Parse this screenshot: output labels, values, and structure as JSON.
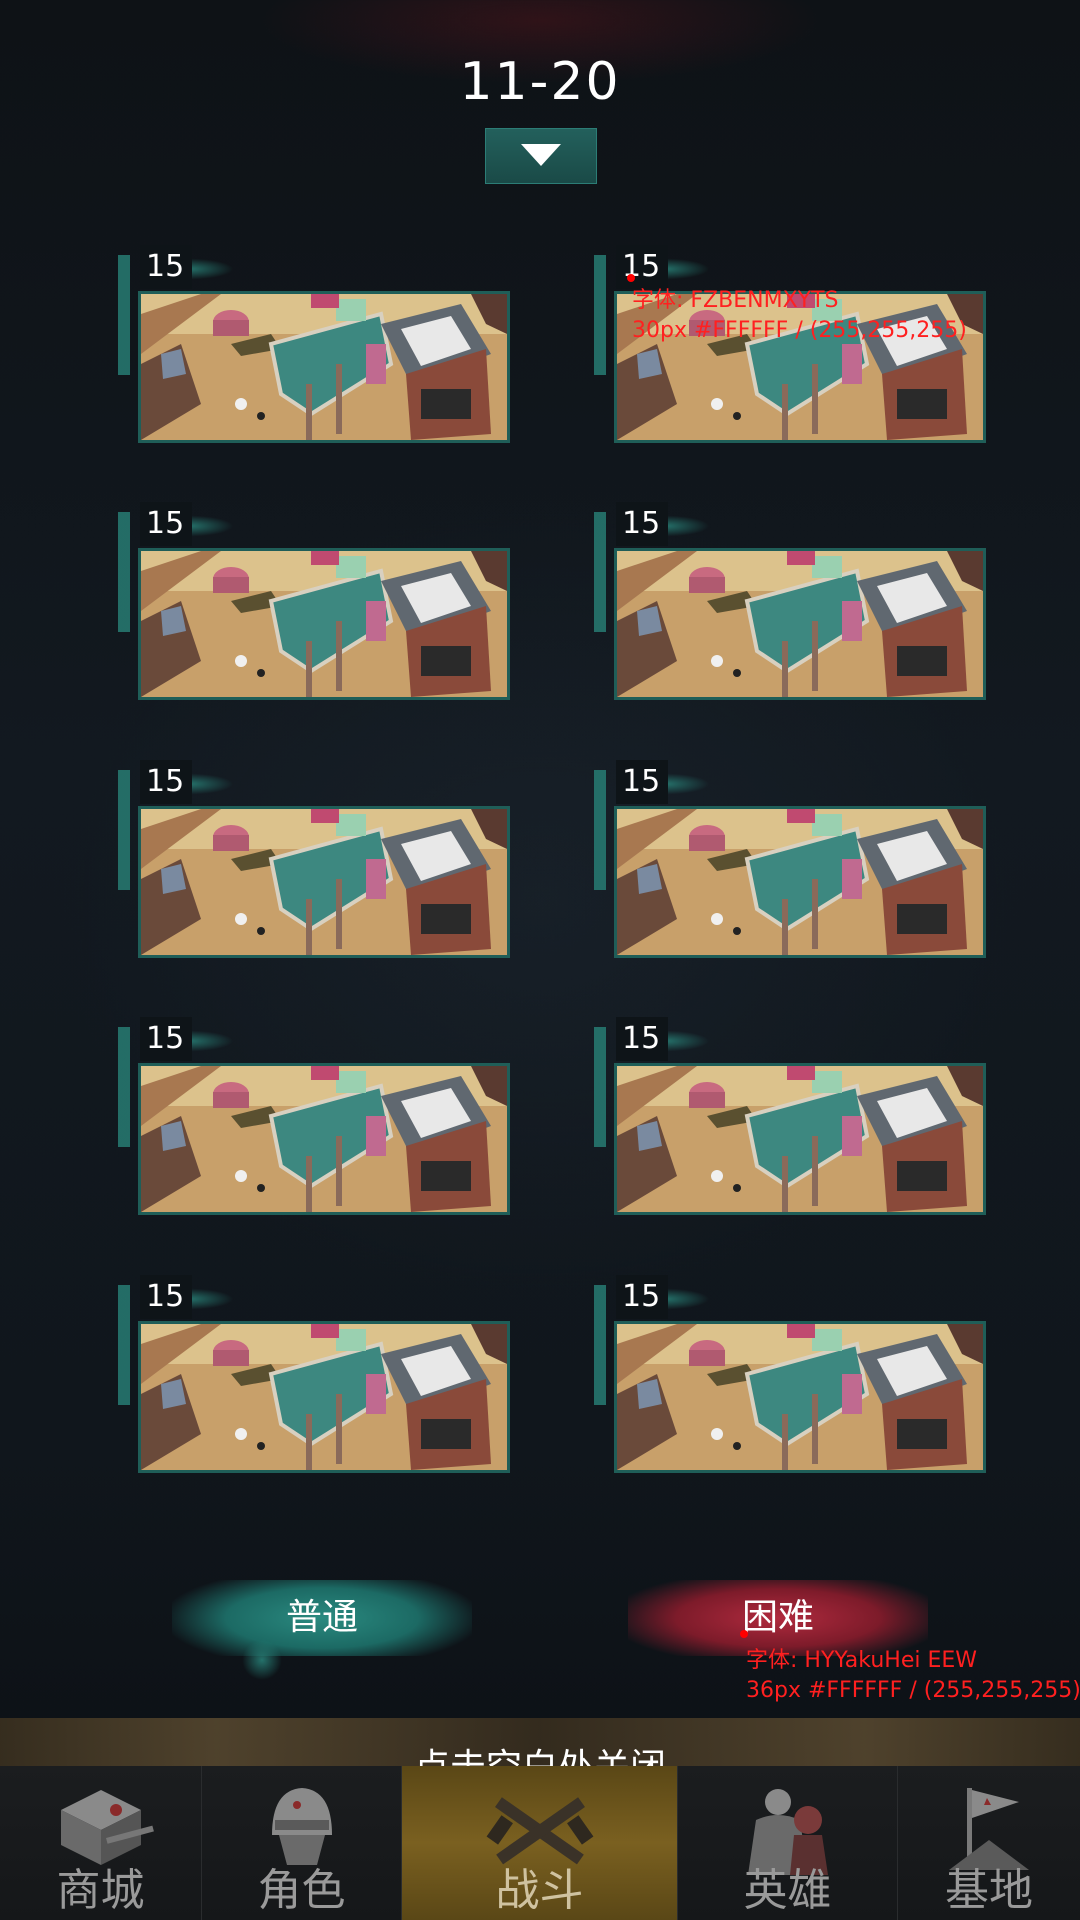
{
  "header": {
    "range_title": "11-20"
  },
  "levels": [
    {
      "number": "15"
    },
    {
      "number": "15"
    },
    {
      "number": "15"
    },
    {
      "number": "15"
    },
    {
      "number": "15"
    },
    {
      "number": "15"
    },
    {
      "number": "15"
    },
    {
      "number": "15"
    },
    {
      "number": "15"
    },
    {
      "number": "15"
    }
  ],
  "annotations": {
    "level_number_font": "字体: FZBENMXYTS",
    "level_number_spec": "30px #FFFFFF / (255,255,255)",
    "difficulty_font": "字体: HYYakuHei EEW",
    "difficulty_spec": "36px #FFFFFF / (255,255,255)"
  },
  "difficulty": {
    "normal_label": "普通",
    "hard_label": "困难"
  },
  "close_hint": "点击空白处关闭",
  "nav": {
    "items": [
      {
        "label": "商城",
        "icon": "shop-crate-icon"
      },
      {
        "label": "角色",
        "icon": "character-helmet-icon"
      },
      {
        "label": "战斗",
        "icon": "battle-crossed-guns-icon",
        "active": true
      },
      {
        "label": "英雄",
        "icon": "hero-figure-icon"
      },
      {
        "label": "基地",
        "icon": "base-flag-icon"
      }
    ]
  },
  "colors": {
    "accent_teal": "#1f5e58",
    "hard_red": "#b02a3e",
    "annotation_red": "#ff0000",
    "active_nav_gold": "#7a6020"
  }
}
